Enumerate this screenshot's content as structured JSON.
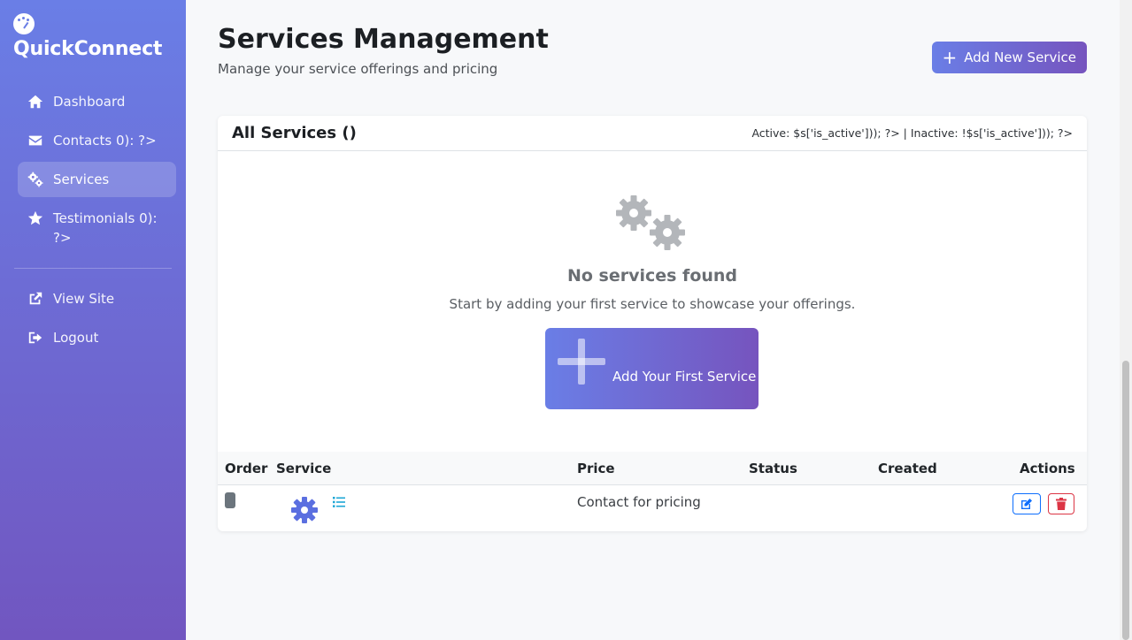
{
  "brand": {
    "name": "QuickConnect",
    "logo_icon": "dashboard-gauge-icon"
  },
  "sidebar": {
    "items": [
      {
        "label": "Dashboard",
        "icon": "home-icon",
        "active": false
      },
      {
        "label": "Contacts 0): ?>",
        "icon": "envelope-icon",
        "active": false
      },
      {
        "label": "Services",
        "icon": "cogs-icon",
        "active": true
      },
      {
        "label": "Testimonials 0): ?>",
        "icon": "star-icon",
        "active": false
      }
    ],
    "secondary": [
      {
        "label": "View Site",
        "icon": "external-link-icon"
      },
      {
        "label": "Logout",
        "icon": "sign-out-icon"
      }
    ]
  },
  "header": {
    "title": "Services Management",
    "subtitle": "Manage your service offerings and pricing",
    "add_button": "Add New Service"
  },
  "card": {
    "title": "All Services ()",
    "stats": "Active: $s['is_active'])); ?> | Inactive: !$s['is_active'])); ?>"
  },
  "empty_state": {
    "title": "No services found",
    "text": "Start by adding your first service to showcase your offerings.",
    "button": "Add Your First Service"
  },
  "table": {
    "columns": [
      "Order",
      "Service",
      "Price",
      "Status",
      "Created",
      "Actions"
    ],
    "rows": [
      {
        "order": "",
        "service": "",
        "price": "Contact for pricing",
        "status": "",
        "created": ""
      }
    ]
  },
  "colors": {
    "sidebar_top": "#6a7ee6",
    "sidebar_bottom": "#7156c0",
    "accent": "#6a7ee6",
    "edit": "#0d6efd",
    "delete": "#dc3545"
  }
}
